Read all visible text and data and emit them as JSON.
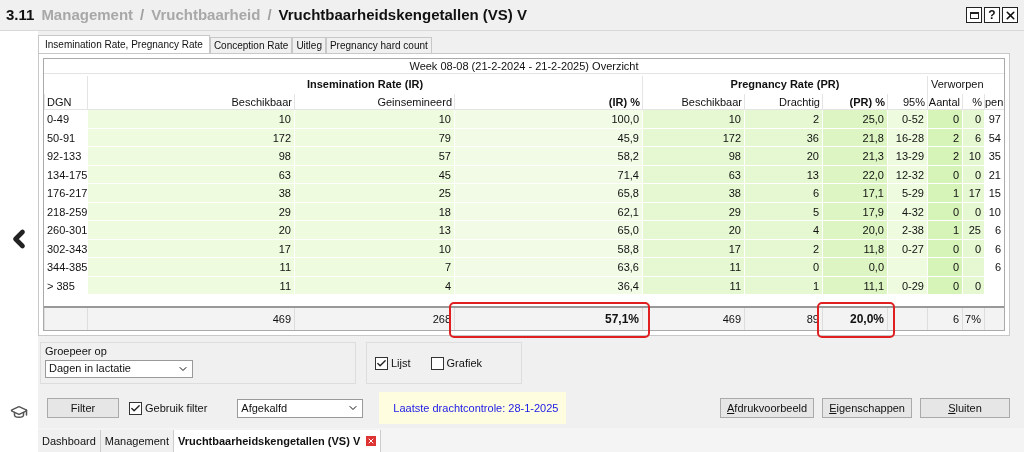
{
  "title_bar": {
    "number": "3.11",
    "breadcrumb": [
      {
        "label": "Management",
        "current": false
      },
      {
        "label": "Vruchtbaarheid",
        "current": false
      },
      {
        "label": "Vruchtbaarheidskengetallen (VS) V",
        "current": true
      }
    ],
    "separator": "/",
    "help": "?"
  },
  "tabs": [
    {
      "label": "Insemination Rate, Pregnancy Rate",
      "selected": true
    },
    {
      "label": "Conception Rate",
      "selected": false
    },
    {
      "label": "Uitleg",
      "selected": false
    },
    {
      "label": "Pregnancy hard count",
      "selected": false
    }
  ],
  "table": {
    "caption": "Week 08-08 (21-2-2024 - 21-2-2025) Overzicht",
    "groups": [
      {
        "label": "Insemination Rate (IR)"
      },
      {
        "label": "Pregnancy Rate (PR)"
      },
      {
        "label": "Verworpen"
      }
    ],
    "columns": [
      "DGN",
      "Beschikbaar",
      "Geinsemineerd",
      "(IR) %",
      "Beschikbaar",
      "Drachtig",
      "(PR) %",
      "95%",
      "Aantal",
      "%",
      "pen"
    ],
    "rows": [
      [
        "0-49",
        "10",
        "10",
        "100,0",
        "10",
        "2",
        "25,0",
        "0-52",
        "0",
        "0",
        "97"
      ],
      [
        "50-91",
        "172",
        "79",
        "45,9",
        "172",
        "36",
        "21,8",
        "16-28",
        "2",
        "6",
        "54"
      ],
      [
        "92-133",
        "98",
        "57",
        "58,2",
        "98",
        "20",
        "21,3",
        "13-29",
        "2",
        "10",
        "35"
      ],
      [
        "134-175",
        "63",
        "45",
        "71,4",
        "63",
        "13",
        "22,0",
        "12-32",
        "0",
        "0",
        "21"
      ],
      [
        "176-217",
        "38",
        "25",
        "65,8",
        "38",
        "6",
        "17,1",
        "5-29",
        "1",
        "17",
        "15"
      ],
      [
        "218-259",
        "29",
        "18",
        "62,1",
        "29",
        "5",
        "17,9",
        "4-32",
        "0",
        "0",
        "10"
      ],
      [
        "260-301",
        "20",
        "13",
        "65,0",
        "20",
        "4",
        "20,0",
        "2-38",
        "1",
        "25",
        "6"
      ],
      [
        "302-343",
        "17",
        "10",
        "58,8",
        "17",
        "2",
        "11,8",
        "0-27",
        "0",
        "0",
        "6"
      ],
      [
        "344-385",
        "11",
        "7",
        "63,6",
        "11",
        "0",
        "0,0",
        null,
        "0",
        null,
        "6"
      ],
      [
        "> 385",
        "11",
        "4",
        "36,4",
        "11",
        "1",
        "11,1",
        "0-29",
        "0",
        "0",
        null
      ]
    ],
    "totals": [
      {
        "highlighted": false
      },
      {
        "text": "469",
        "highlighted": false
      },
      {
        "text": "268",
        "highlighted": false
      },
      {
        "text": "57,1%",
        "highlighted": true
      },
      {
        "text": "469",
        "highlighted": false
      },
      {
        "text": "89",
        "highlighted": false
      },
      {
        "text": "20,0%",
        "highlighted": true
      },
      {
        "highlighted": false
      },
      {
        "text": "6",
        "highlighted": false
      },
      {
        "text": "7%",
        "highlighted": false
      },
      {
        "highlighted": false
      }
    ]
  },
  "group_by": {
    "label": "Groepeer op",
    "value": "Dagen in lactatie"
  },
  "view": [
    {
      "label": "Lijst",
      "checked": true
    },
    {
      "label": "Grafiek",
      "checked": false
    }
  ],
  "filter": {
    "button": "Filter",
    "use_filter": {
      "label": "Gebruik filter",
      "checked": true
    },
    "value": "Afgekalfd"
  },
  "info": "Laatste drachtcontrole: 28-1-2025",
  "actions": [
    {
      "label": "Afdrukvoorbeeld",
      "mnemonic": true
    },
    {
      "label": "Eigenschappen",
      "mnemonic": true
    },
    {
      "label": "Sluiten",
      "mnemonic": true
    }
  ],
  "bottom_tabs": [
    {
      "label": "Dashboard",
      "selected": false,
      "closable": false
    },
    {
      "label": "Management",
      "selected": false,
      "closable": false
    },
    {
      "label": "Vruchtbaarheidskengetallen (VS) V",
      "selected": true,
      "closable": true
    }
  ]
}
